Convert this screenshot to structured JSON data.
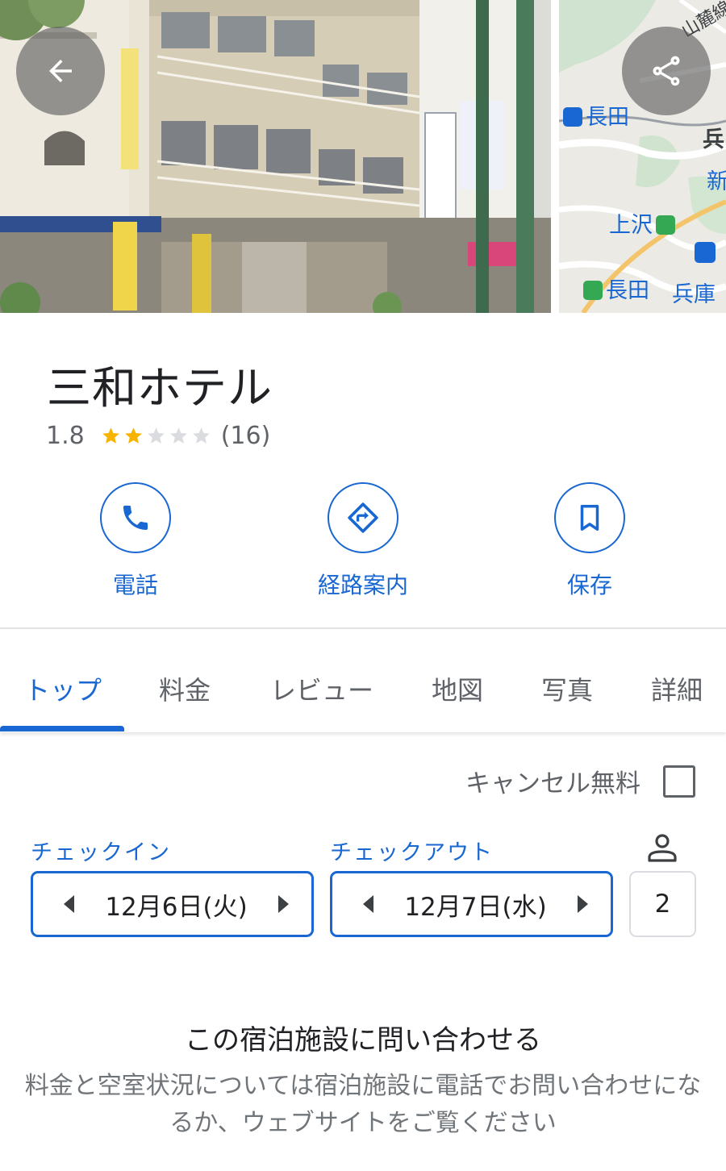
{
  "colors": {
    "accent": "#1967d2",
    "star_filled": "#f6b400",
    "star_empty": "#dadce0",
    "text_primary": "#202124",
    "text_secondary": "#5f6368"
  },
  "header": {
    "back_icon": "arrow-left-icon",
    "share_icon": "share-icon"
  },
  "map_thumbnail": {
    "labels": [
      {
        "text": "山麓線"
      },
      {
        "text": "長田"
      },
      {
        "text": "兵"
      },
      {
        "text": "新"
      },
      {
        "text": "上沢"
      },
      {
        "text": "長田"
      },
      {
        "text": "兵庫"
      }
    ]
  },
  "place": {
    "name": "三和ホテル",
    "rating": "1.8",
    "rating_value": 1.8,
    "stars_filled": 2,
    "stars_total": 5,
    "review_count": "(16)"
  },
  "actions": {
    "call": {
      "label": "電話",
      "icon": "phone-icon"
    },
    "directions": {
      "label": "経路案内",
      "icon": "directions-icon"
    },
    "save": {
      "label": "保存",
      "icon": "bookmark-icon"
    }
  },
  "tabs": [
    {
      "label": "トップ",
      "active": true
    },
    {
      "label": "料金",
      "active": false
    },
    {
      "label": "レビュー",
      "active": false
    },
    {
      "label": "地図",
      "active": false
    },
    {
      "label": "写真",
      "active": false
    },
    {
      "label": "詳細",
      "active": false
    }
  ],
  "booking": {
    "free_cancel_label": "キャンセル無料",
    "free_cancel_checked": false,
    "checkin_label": "チェックイン",
    "checkin_date": "12月6日(火)",
    "checkout_label": "チェックアウト",
    "checkout_date": "12月7日(水)",
    "guests": "2",
    "guests_icon": "person-icon"
  },
  "contact": {
    "heading": "この宿泊施設に問い合わせる",
    "body": "料金と空室状況については宿泊施設に電話でお問い合わせになるか、ウェブサイトをご覧ください"
  }
}
